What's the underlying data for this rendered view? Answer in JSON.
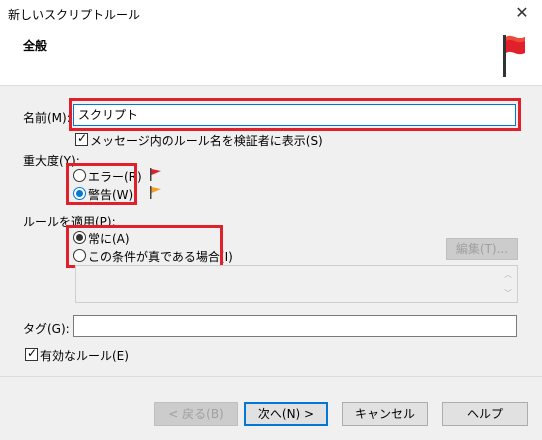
{
  "window": {
    "title": "新しいスクリプトルール",
    "close_glyph": "✕"
  },
  "header": {
    "title": "全般"
  },
  "form": {
    "name_label": "名前(M):",
    "name_value": "スクリプト",
    "validate_checkbox_label": "メッセージ内のルール名を検証者に表示(S)",
    "validate_checked": true,
    "severity_label": "重大度(Y):",
    "severity_options": [
      {
        "label": "エラー(R)",
        "checked": false
      },
      {
        "label": "警告(W)",
        "checked": true
      }
    ],
    "apply_label": "ルールを適用(P):",
    "apply_options": [
      {
        "label": "常に(A)",
        "checked": true
      },
      {
        "label": "この条件が真である場合(I)",
        "checked": false
      }
    ],
    "edit_button": "編集(T)...",
    "tag_label": "タグ(G):",
    "tag_value": "",
    "enabled_checkbox_label": "有効なルール(E)",
    "enabled_checked": true
  },
  "footer": {
    "back_button": "< 戻る(B)",
    "next_button": "次へ(N) >",
    "cancel_button": "キャンセル",
    "help_button": "ヘルプ"
  },
  "colors": {
    "accent": "#0078d7",
    "highlight_border": "#e0202b",
    "error_flag": "#d9232d",
    "warning_flag": "#f0a020"
  }
}
